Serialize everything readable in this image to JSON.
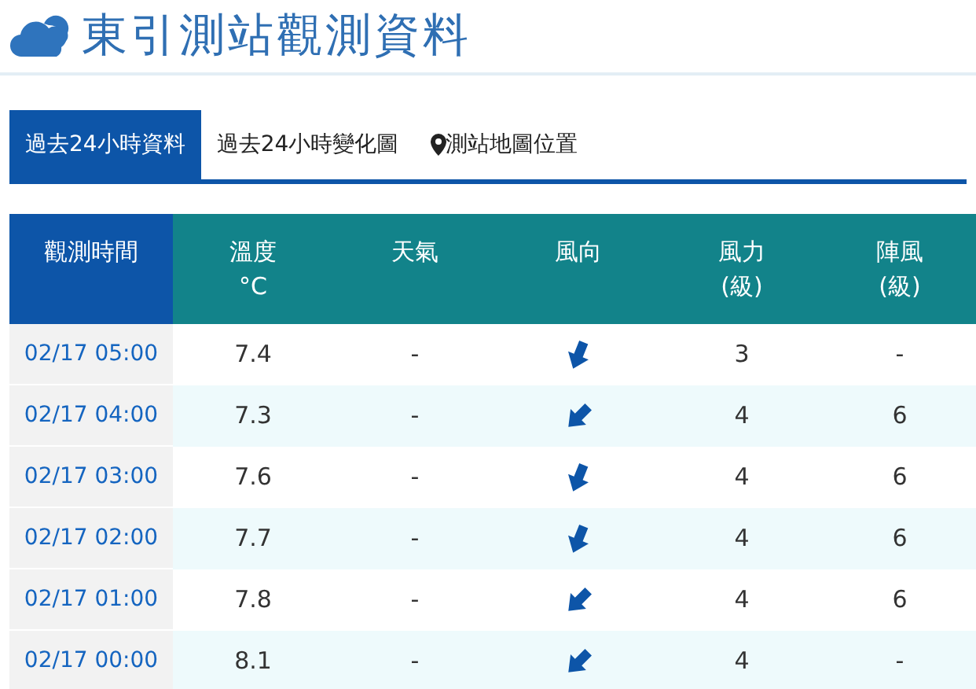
{
  "title": "東引測站觀測資料",
  "tabs": [
    {
      "label": "過去24小時資料",
      "selected": true,
      "kind": "text"
    },
    {
      "label": "過去24小時變化圖",
      "selected": false,
      "kind": "text"
    },
    {
      "label": "測站地圖位置",
      "selected": false,
      "kind": "map"
    }
  ],
  "table": {
    "columns": [
      {
        "label": "觀測時間"
      },
      {
        "label": "溫度",
        "sub": "°C"
      },
      {
        "label": "天氣"
      },
      {
        "label": "風向"
      },
      {
        "label": "風力",
        "sub": "(級)"
      },
      {
        "label": "陣風",
        "sub": "(級)"
      }
    ],
    "rows": [
      {
        "time": "02/17 05:00",
        "temp": "7.4",
        "weather": "-",
        "kind": "nne",
        "force": "3",
        "gust": "-"
      },
      {
        "time": "02/17 04:00",
        "temp": "7.3",
        "weather": "-",
        "kind": "ne",
        "force": "4",
        "gust": "6"
      },
      {
        "time": "02/17 03:00",
        "temp": "7.6",
        "weather": "-",
        "kind": "nne",
        "force": "4",
        "gust": "6"
      },
      {
        "time": "02/17 02:00",
        "temp": "7.7",
        "weather": "-",
        "kind": "nne",
        "force": "4",
        "gust": "6"
      },
      {
        "time": "02/17 01:00",
        "temp": "7.8",
        "weather": "-",
        "kind": "ne",
        "force": "4",
        "gust": "6"
      },
      {
        "time": "02/17 00:00",
        "temp": "8.1",
        "weather": "-",
        "kind": "ne",
        "force": "4",
        "gust": "-"
      }
    ]
  }
}
